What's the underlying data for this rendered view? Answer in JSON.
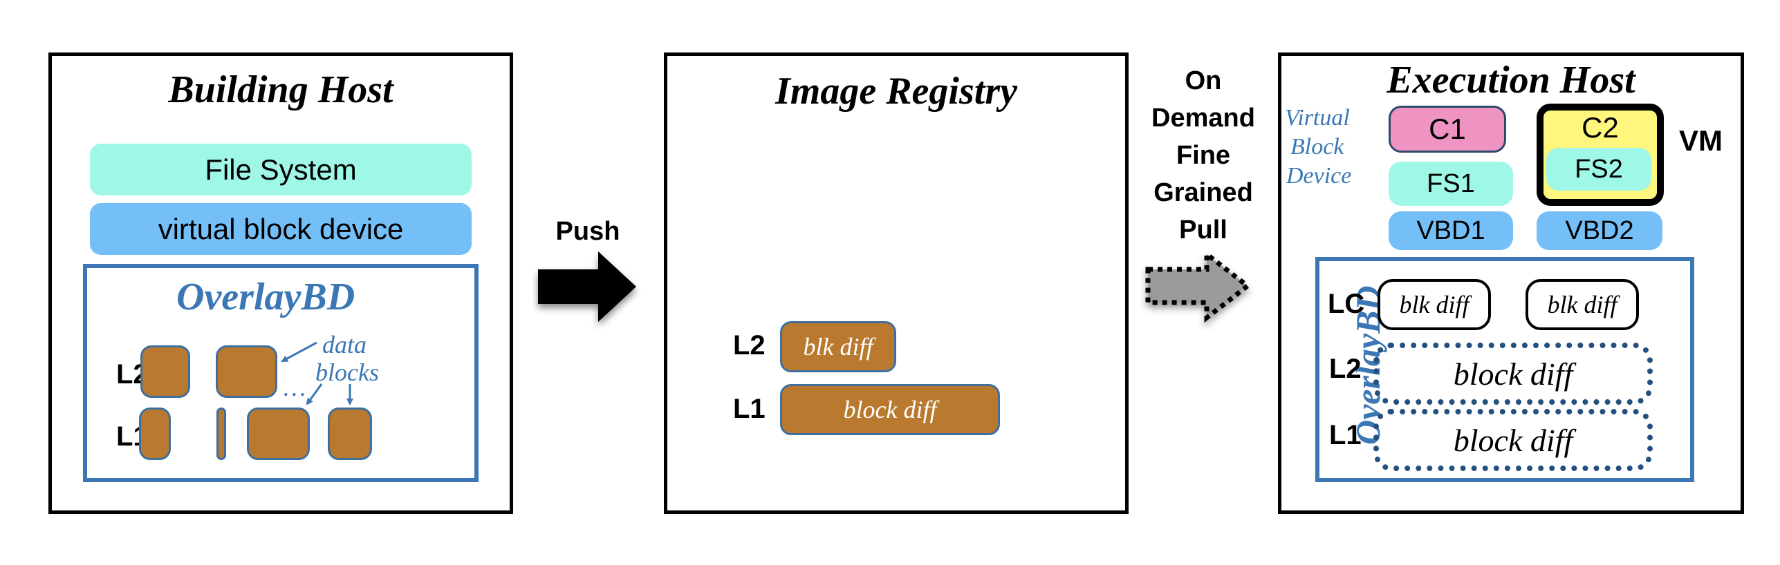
{
  "building_host": {
    "title": "Building Host",
    "file_system": "File System",
    "virtual_block_device": "virtual block device",
    "overlaybd": {
      "title": "OverlayBD",
      "layer_labels": [
        "L2",
        "L1"
      ],
      "annotation": [
        "data",
        "blocks"
      ],
      "ellipsis": "…"
    }
  },
  "push": {
    "label": "Push"
  },
  "image_registry": {
    "title": "Image Registry",
    "layers": [
      {
        "label": "L2",
        "text": "blk diff"
      },
      {
        "label": "L1",
        "text": "block diff"
      }
    ]
  },
  "pull": {
    "label_lines": [
      "On",
      "Demand",
      "Fine",
      "Grained",
      "Pull"
    ]
  },
  "execution_host": {
    "title": "Execution Host",
    "vbd_annotation": [
      "Virtual",
      "Block",
      "Device"
    ],
    "containers": [
      {
        "name": "C1",
        "fs": "FS1",
        "vbd": "VBD1"
      },
      {
        "name": "C2",
        "fs": "FS2",
        "vbd": "VBD2"
      }
    ],
    "vm_label": "VM",
    "overlaybd": {
      "title": "OverlayBD",
      "lc_label": "LC",
      "lc_blocks": [
        "blk diff",
        "blk diff"
      ],
      "layers": [
        {
          "label": "L2",
          "text": "block diff"
        },
        {
          "label": "L1",
          "text": "block diff"
        }
      ]
    }
  },
  "colors": {
    "file_system": "#9ff7e8",
    "virtual_block_device": "#74bff7",
    "overlaybd_blue": "#3a77b4",
    "data_block": "#b97a2f",
    "c1": "#ee93c2",
    "c2": "#fef67d",
    "dotted_border": "#23507f"
  }
}
